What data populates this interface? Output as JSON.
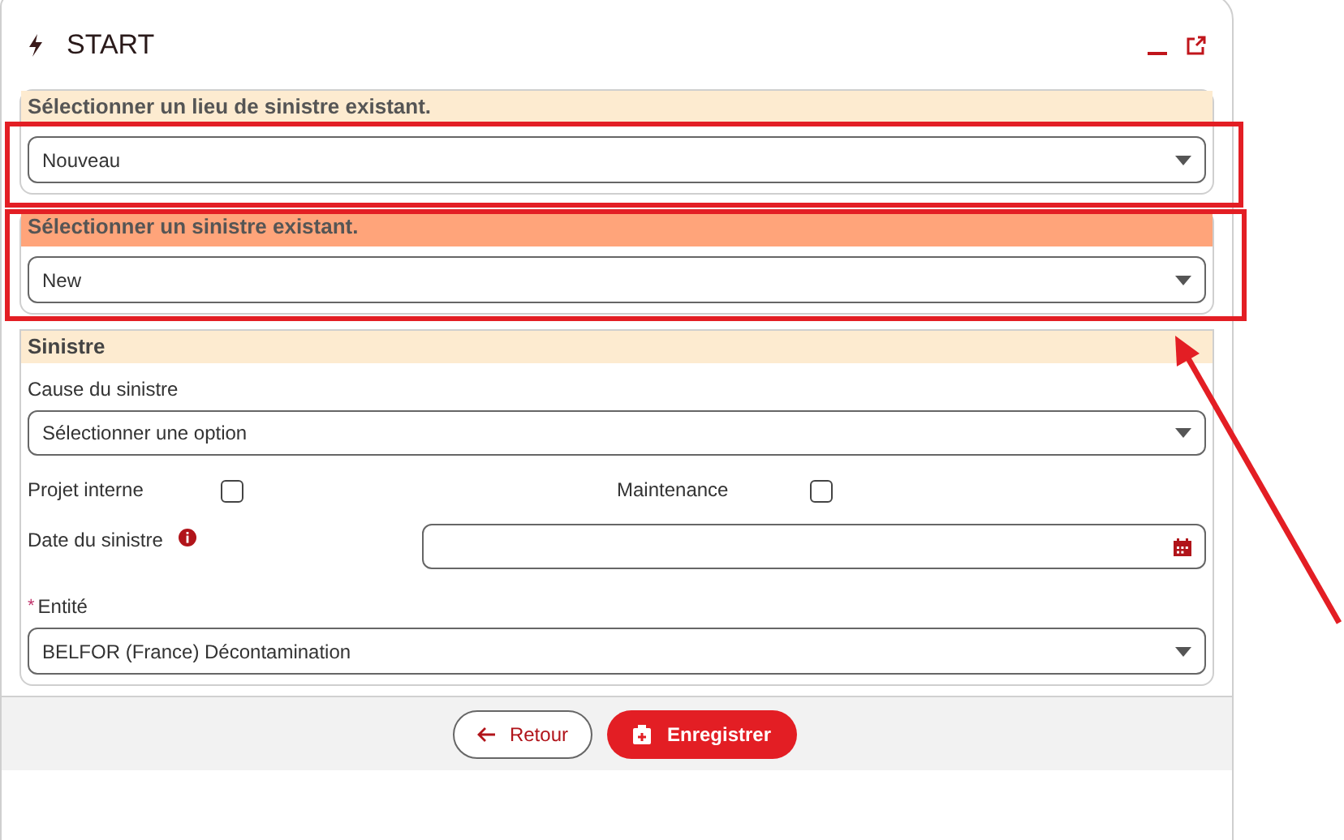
{
  "dialog": {
    "title": "START"
  },
  "lookups": [
    {
      "heading": "Sélectionner un lieu de sinistre existant.",
      "color": "#fdebd0",
      "value": "Nouveau"
    },
    {
      "heading": "Sélectionner un sinistre existant.",
      "color": "#ffa47a",
      "value": "New"
    }
  ],
  "sinistre": {
    "heading": "Sinistre",
    "cause_label": "Cause du sinistre",
    "cause_placeholder": "Sélectionner une option",
    "checkboxes": [
      {
        "label": "Projet interne",
        "checked": false
      },
      {
        "label": "Maintenance",
        "checked": false
      }
    ],
    "date_label": "Date du sinistre",
    "entity_required": "*",
    "entity_label": "Entité",
    "entity_value": "BELFOR (France) Décontamination"
  },
  "buttons": [
    {
      "kind": "back",
      "label": "Retour"
    },
    {
      "kind": "save",
      "label": "Enregistrer"
    }
  ]
}
